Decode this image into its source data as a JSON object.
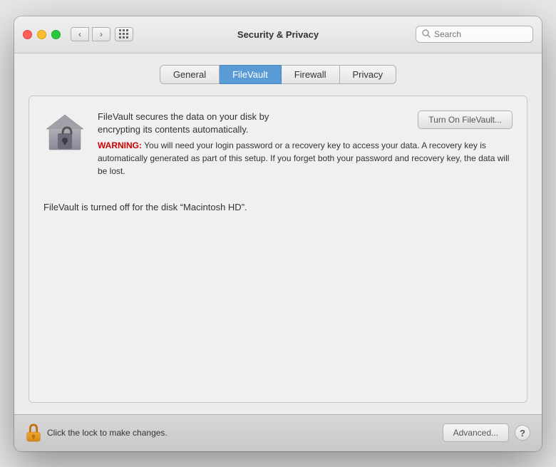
{
  "window": {
    "title": "Security & Privacy",
    "traffic_lights": {
      "close_label": "close",
      "minimize_label": "minimize",
      "maximize_label": "maximize"
    }
  },
  "toolbar": {
    "nav_back": "‹",
    "nav_forward": "›",
    "search_placeholder": "Search"
  },
  "tabs": [
    {
      "id": "general",
      "label": "General",
      "active": false
    },
    {
      "id": "filevault",
      "label": "FileVault",
      "active": true
    },
    {
      "id": "firewall",
      "label": "Firewall",
      "active": false
    },
    {
      "id": "privacy",
      "label": "Privacy",
      "active": false
    }
  ],
  "filevault": {
    "description_line1": "FileVault secures the data on your disk by",
    "description_line2": "encrypting its contents automatically.",
    "warning_label": "WARNING:",
    "warning_text": " You will need your login password or a recovery key to access your data. A recovery key is automatically generated as part of this setup. If you forget both your password and recovery key, the data will be lost.",
    "turn_on_button": "Turn On FileVault...",
    "status_text": "FileVault is turned off for the disk “Macintosh HD”."
  },
  "bottom_bar": {
    "lock_label": "Click the lock to make changes.",
    "advanced_button": "Advanced...",
    "help_button": "?"
  }
}
